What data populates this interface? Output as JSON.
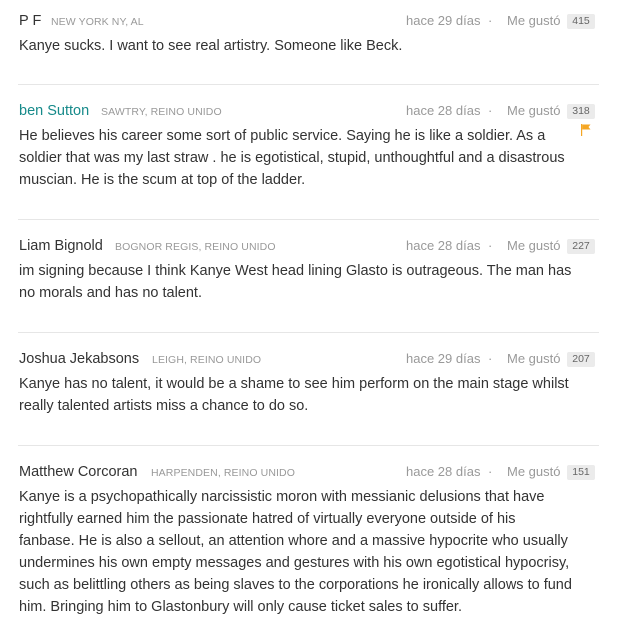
{
  "colors": {
    "author_link": "#168a8a",
    "author_default": "#333333",
    "muted": "#999999",
    "badge_bg": "#ebebeb",
    "flag": "#f5a623",
    "divider": "#e6e6e6"
  },
  "like_label": "Me gustó",
  "separator": "·",
  "comments": [
    {
      "author": "P F",
      "location": "NEW YORK NY, AL",
      "time": "hace 29 días",
      "likes": "415",
      "text": "Kanye sucks. I want to see real artistry. Someone like Beck.",
      "flag_icon": null
    },
    {
      "author": "ben Sutton",
      "location": "SAWTRY, REINO UNIDO",
      "time": "hace 28 días",
      "likes": "318",
      "text": "He believes his career some sort of public service. Saying he is like a soldier. As a soldier that was my last straw . he is egotistical, stupid, unthoughtful and a disastrous muscian. He is the scum at top of the ladder.",
      "flag_icon": "flag-icon"
    },
    {
      "author": "Liam Bignold",
      "location": "BOGNOR REGIS, REINO UNIDO",
      "time": "hace 28 días",
      "likes": "227",
      "text": "im signing because I think Kanye West head lining Glasto is outrageous. The man has no morals and has no talent.",
      "flag_icon": null
    },
    {
      "author": "Joshua Jekabsons",
      "location": "LEIGH, REINO UNIDO",
      "time": "hace 29 días",
      "likes": "207",
      "text": "Kanye has no talent, it would be a shame to see him perform on the main stage whilst really talented artists miss a chance to do so.",
      "flag_icon": null
    },
    {
      "author": "Matthew Corcoran",
      "location": "HARPENDEN, REINO UNIDO",
      "time": "hace 28 días",
      "likes": "151",
      "text": "Kanye is a psychopathically narcissistic moron with messianic delusions that have rightfully earned him the passionate hatred of virtually everyone outside of his fanbase. He is also a sellout, an attention whore and a massive hypocrite who usually undermines his own empty messages and gestures with his own egotistical hypocrisy, such as belittling others as being slaves to the corporations he ironically allows to fund him. Bringing him to Glastonbury will only cause ticket sales to suffer.",
      "flag_icon": null
    }
  ]
}
